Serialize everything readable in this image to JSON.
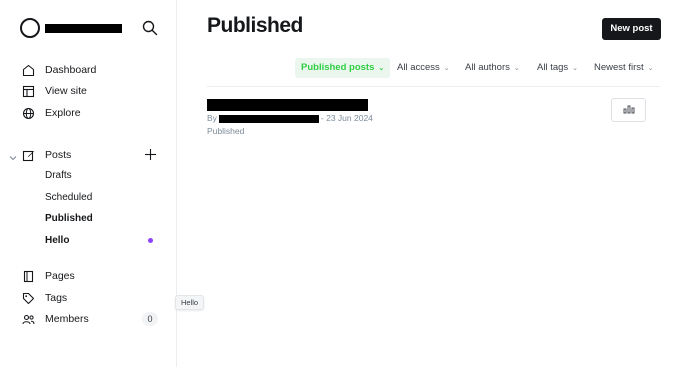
{
  "sidebar": {
    "site_name": "",
    "nav": [
      {
        "label": "Dashboard",
        "icon": "home-icon"
      },
      {
        "label": "View site",
        "icon": "layout-icon"
      },
      {
        "label": "Explore",
        "icon": "globe-icon"
      }
    ],
    "posts": {
      "label": "Posts",
      "icon": "edit-icon",
      "sub": [
        {
          "label": "Drafts"
        },
        {
          "label": "Scheduled"
        },
        {
          "label": "Published"
        },
        {
          "label": "Hello"
        }
      ]
    },
    "bottom_nav": [
      {
        "label": "Pages",
        "icon": "pages-icon"
      },
      {
        "label": "Tags",
        "icon": "tag-icon"
      },
      {
        "label": "Members",
        "icon": "members-icon",
        "count": "0"
      }
    ]
  },
  "tooltip": "Hello",
  "main": {
    "title": "Published",
    "new_post_label": "New post",
    "filters": [
      {
        "label": "Published posts",
        "active": true
      },
      {
        "label": "All access"
      },
      {
        "label": "All authors"
      },
      {
        "label": "All tags"
      },
      {
        "label": "Newest first"
      }
    ],
    "post": {
      "title": "",
      "meta_prefix": "By",
      "date": "- 23 Jun 2024",
      "status": "Published"
    }
  },
  "colors": {
    "accent_green": "#30cf43",
    "dot_purple": "#8e42ff",
    "dark": "#15171a"
  }
}
